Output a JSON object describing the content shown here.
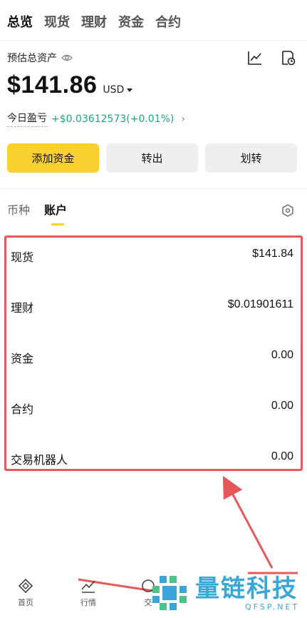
{
  "top_tabs": [
    "总览",
    "现货",
    "理财",
    "资金",
    "合约"
  ],
  "header": {
    "estimated_label": "预估总资产",
    "balance": "$141.86",
    "currency": "USD",
    "pnl_label": "今日盈亏",
    "pnl_value": "+$0.03612573(+0.01%)"
  },
  "buttons": {
    "deposit": "添加资金",
    "withdraw": "转出",
    "transfer": "划转"
  },
  "sub_tabs": [
    "币种",
    "账户"
  ],
  "accounts": [
    {
      "name": "现货",
      "value": "$141.84"
    },
    {
      "name": "理财",
      "value": "$0.01901611"
    },
    {
      "name": "资金",
      "value": "0.00"
    },
    {
      "name": "合约",
      "value": "0.00"
    },
    {
      "name": "交易机器人",
      "value": "0.00"
    }
  ],
  "bottom_nav": [
    "首页",
    "行情",
    "交"
  ],
  "watermark": {
    "text": "量链科技",
    "domain": "QFSP.NET"
  },
  "colors": {
    "accent": "#f9d030",
    "positive": "#1aaa7a",
    "highlight": "#e45a5a",
    "watermark": "#3aa5d8"
  }
}
